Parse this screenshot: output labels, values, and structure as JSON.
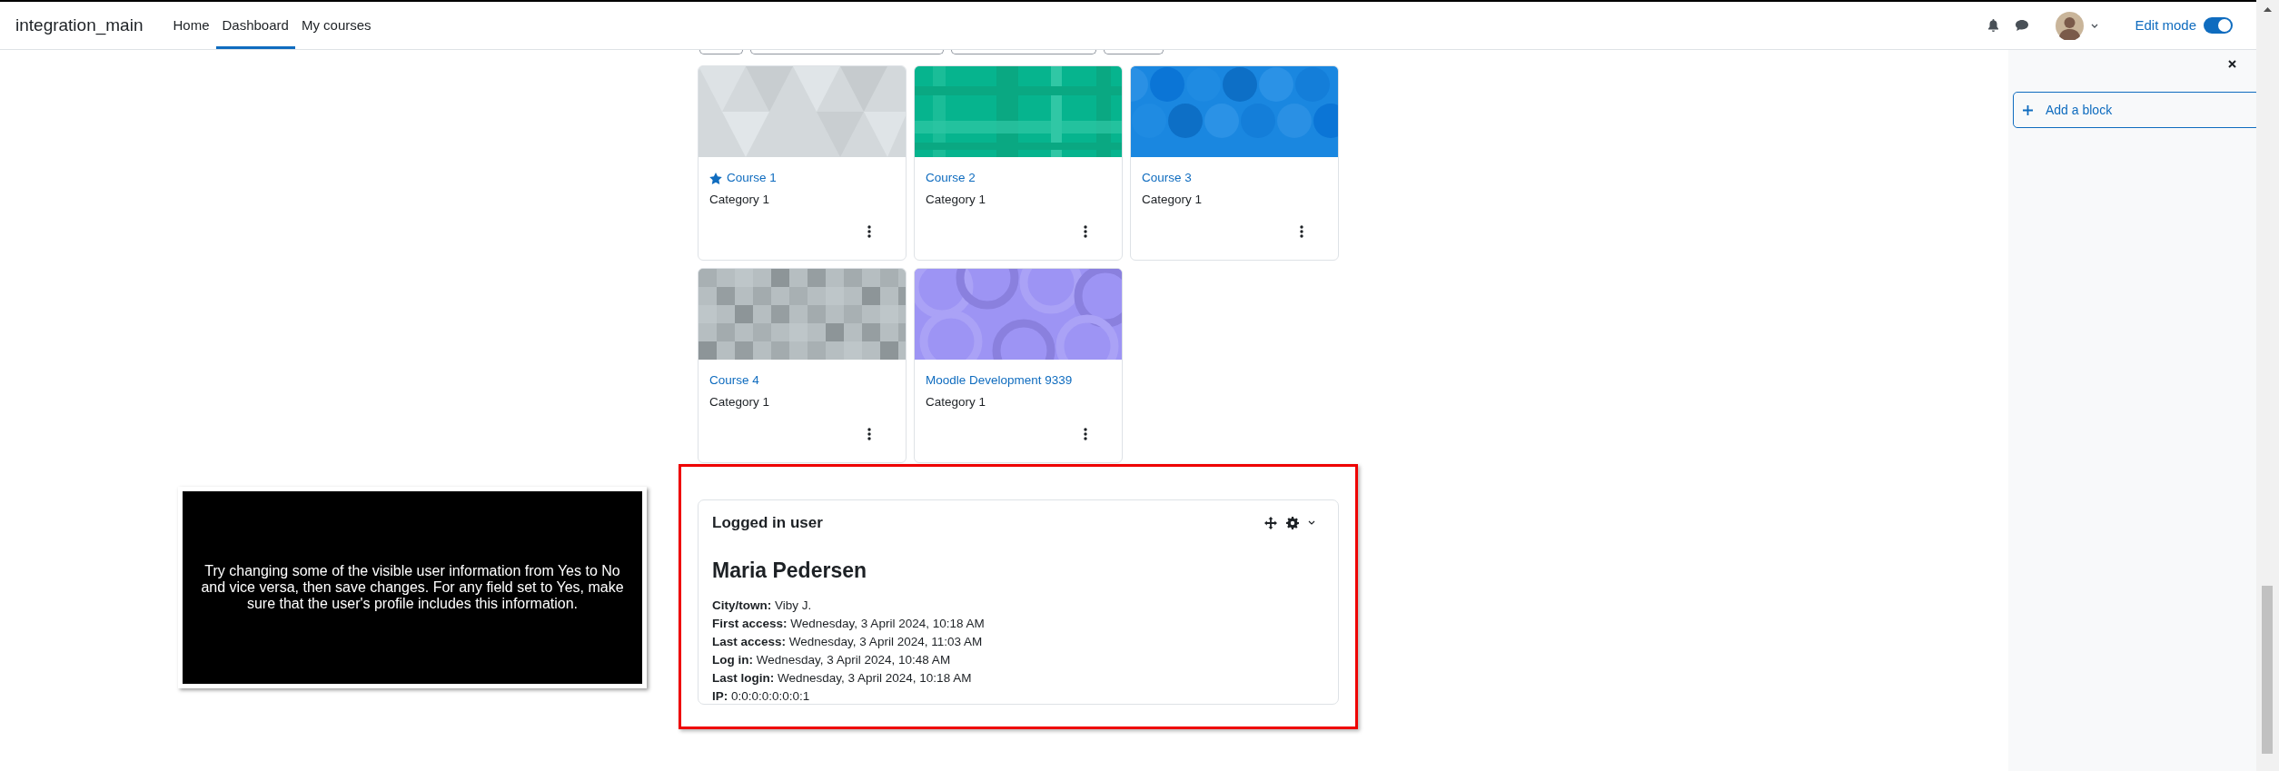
{
  "navbar": {
    "brand": "integration_main",
    "items": [
      {
        "label": "Home",
        "selected": false
      },
      {
        "label": "Dashboard",
        "selected": true
      },
      {
        "label": "My courses",
        "selected": false
      }
    ],
    "edit_mode": {
      "label": "Edit mode",
      "on": true
    }
  },
  "courses": [
    {
      "title": "Course 1",
      "category": "Category 1",
      "starred": true
    },
    {
      "title": "Course 2",
      "category": "Category 1",
      "starred": false
    },
    {
      "title": "Course 3",
      "category": "Category 1",
      "starred": false
    },
    {
      "title": "Course 4",
      "category": "Category 1",
      "starred": false
    },
    {
      "title": "Moodle Development 9339",
      "category": "Category 1",
      "starred": false
    }
  ],
  "logged_in_block": {
    "title": "Logged in user",
    "name": "Maria Pedersen",
    "fields": [
      {
        "label": "City/town:",
        "value": "Viby J."
      },
      {
        "label": "First access:",
        "value": "Wednesday, 3 April 2024, 10:18 AM"
      },
      {
        "label": "Last access:",
        "value": "Wednesday, 3 April 2024, 11:03 AM"
      },
      {
        "label": "Log in:",
        "value": "Wednesday, 3 April 2024, 10:48 AM"
      },
      {
        "label": "Last login:",
        "value": "Wednesday, 3 April 2024, 10:18 AM"
      },
      {
        "label": "IP:",
        "value": "0:0:0:0:0:0:0:1"
      }
    ]
  },
  "tour_tip": {
    "text": "Try changing some of the visible user information from Yes to No and vice versa, then save changes. For any field set to Yes, make sure that the user's profile includes this information."
  },
  "drawer": {
    "add_block": "Add a block"
  }
}
